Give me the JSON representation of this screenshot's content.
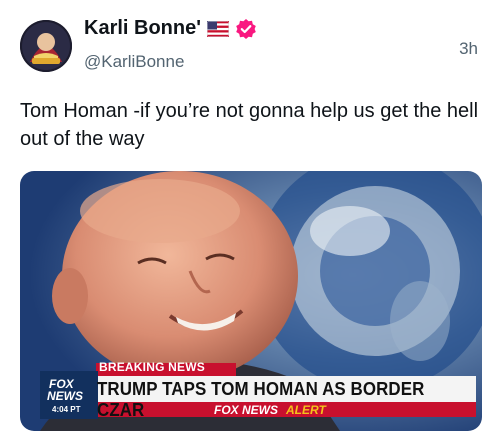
{
  "post": {
    "author": {
      "display_name": "Karli Bonne'",
      "handle": "@KarliBonne",
      "flag_icon": "us-flag-icon",
      "verified_icon": "verified-badge-icon",
      "verified_color": "#f91880"
    },
    "timestamp": "3h",
    "text": "Tom Homan -if you’re not gonna help us get the hell out of the way"
  },
  "media": {
    "chyron": {
      "tag": "BREAKING NEWS",
      "headline": "TRUMP TAPS TOM HOMAN AS BORDER CZAR",
      "alert_brand": "FOX NEWS",
      "alert_word": "ALERT",
      "logo_line1": "FOX",
      "logo_line2": "NEWS",
      "logo_time": "4:04 PT"
    },
    "colors": {
      "tag_red": "#c8102e",
      "alert_gold": "#f4c21b",
      "logo_blue": "#12305e"
    }
  }
}
